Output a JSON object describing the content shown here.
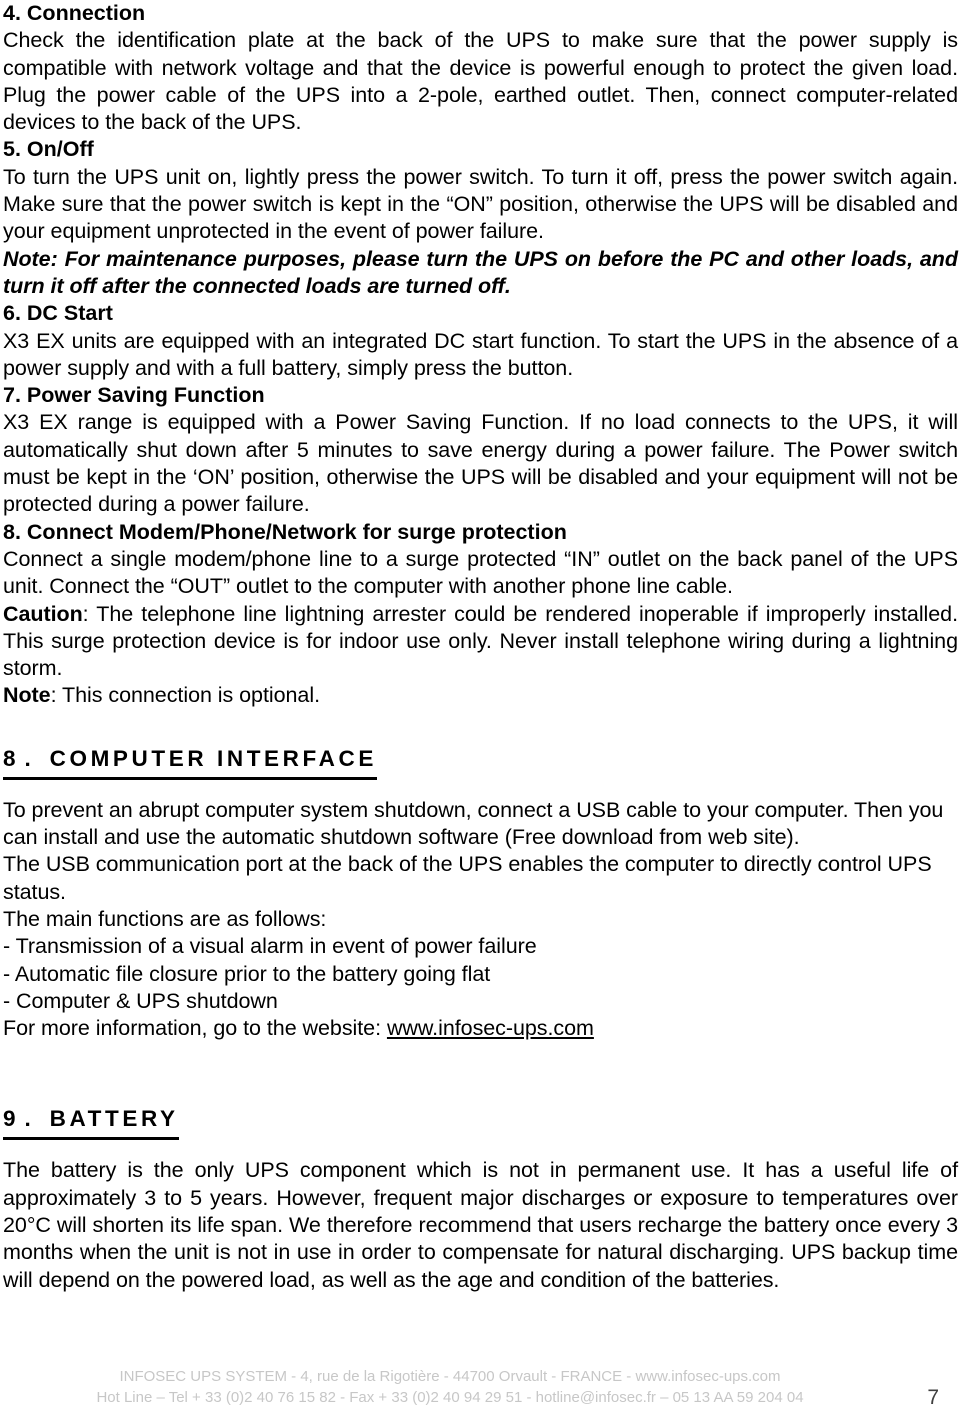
{
  "document": {
    "page_number": "7"
  },
  "sections": {
    "connection": {
      "heading": "4. Connection",
      "body": "Check the identification plate at the back of the UPS to make sure that the power supply is compatible with network voltage and that the device is powerful enough to protect the given load. Plug the power cable of the UPS into a 2-pole, earthed outlet. Then, connect computer-related devices to the back of the UPS."
    },
    "onoff": {
      "heading": "5. On/Off",
      "body": "To turn the UPS unit on, lightly press the power switch. To turn it off, press the power switch again. Make sure that the power switch is kept in the “ON” position, otherwise the UPS will be disabled and your equipment unprotected in the event of power failure.",
      "note_label": "Note",
      "note_sep": ": ",
      "note_text": "For maintenance purposes, please turn the UPS on before the PC and other loads, and turn it off after the connected loads are turned off."
    },
    "dcstart": {
      "heading": "6. DC Start",
      "body": "X3 EX units are equipped with an integrated DC start function. To start the UPS in the absence of a power supply and with a full battery, simply press the button."
    },
    "powersaving": {
      "heading": "7. Power Saving Function",
      "body": "X3 EX range is equipped with a Power Saving Function. If no load connects to the UPS, it will automatically shut down after 5 minutes to save energy during a power failure. The Power switch must be kept in the ‘ON’ position, otherwise the UPS will be disabled and your equipment will not be protected during a power failure."
    },
    "modem": {
      "heading": "8. Connect Modem/Phone/Network for surge protection",
      "body": "Connect a single modem/phone line to a surge protected “IN” outlet on the back panel of the UPS unit. Connect the “OUT” outlet to the computer with another phone line cable.",
      "caution_label": "Caution",
      "caution_sep": ": ",
      "caution_text": "The telephone line lightning arrester could be rendered inoperable if improperly installed. This surge protection device is for indoor use only. Never install telephone wiring during a lightning storm.",
      "note_label": "Note",
      "note_sep": ": ",
      "note_text": "This connection is optional."
    },
    "computer_interface": {
      "heading_num": "8.",
      "heading_text": " COMPUTER INTERFACE",
      "para1": "To prevent an abrupt computer system shutdown, connect a USB cable to your computer. Then you can install and use the automatic shutdown software (Free download from web site).",
      "para2": "The USB communication port at the back of the UPS enables the computer to directly control UPS status.",
      "para3": "The main functions are as follows:",
      "bullets": [
        "- Transmission of a visual alarm in event of power failure",
        "- Automatic file closure prior to the battery going flat",
        "- Computer & UPS shutdown"
      ],
      "website_prefix": "For more information, go to the website: ",
      "website_link": "www.infosec-ups.com"
    },
    "battery": {
      "heading_num": "9.",
      "heading_text": " BATTERY",
      "body": "The battery is the only UPS component which is not in permanent use. It has a useful life of approximately 3 to 5 years. However, frequent major discharges or exposure to temperatures over 20°C will shorten its life span. We therefore recommend that users recharge the battery once every 3 months when the unit is not in use in order to compensate for natural discharging. UPS backup time will depend on the powered load, as well as the age and condition of the batteries."
    }
  },
  "footer": {
    "line1": "INFOSEC UPS SYSTEM - 4, rue de la Rigotière - 44700 Orvault - FRANCE -  www.infosec-ups.com",
    "line2": "Hot Line – Tel + 33 (0)2 40 76 15 82 - Fax + 33 (0)2 40 94 29 51 - hotline@infosec.fr – 05 13 AA 59 204 04"
  }
}
